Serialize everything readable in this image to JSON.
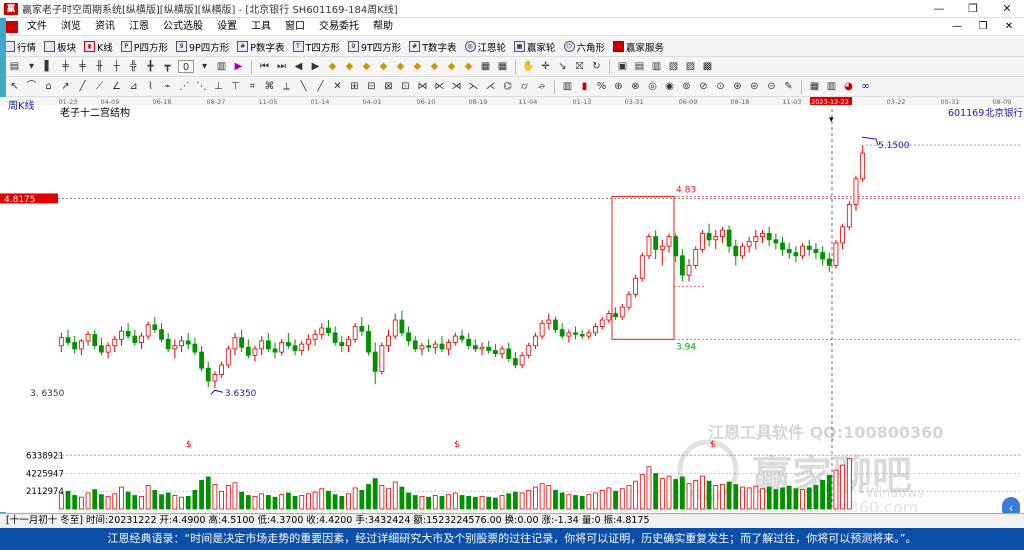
{
  "window": {
    "title": "赢家老子时空周期系统[纵横版][纵横版][纵横版] - [北京银行  SH601169-184周K线]",
    "logo_text": "赢"
  },
  "menu": [
    "文件",
    "浏览",
    "资讯",
    "江恩",
    "公式选股",
    "设置",
    "工具",
    "窗口",
    "交易委托",
    "帮助"
  ],
  "toolbar1": [
    {
      "icon": "grid-icon",
      "label": "行情"
    },
    {
      "icon": "blocks-icon",
      "label": "板块"
    },
    {
      "icon": "kline-icon",
      "label": "K线"
    },
    {
      "icon": "p-square-icon",
      "label": "P四方形"
    },
    {
      "icon": "9p-square-icon",
      "label": "9P四方形"
    },
    {
      "icon": "p-number-icon",
      "label": "P数字表"
    },
    {
      "icon": "t-square-icon",
      "label": "T四方形"
    },
    {
      "icon": "9t-square-icon",
      "label": "9T四方形"
    },
    {
      "icon": "t-number-icon",
      "label": "T数字表"
    },
    {
      "icon": "gann-wheel-icon",
      "label": "江恩轮"
    },
    {
      "icon": "winner-wheel-icon",
      "label": "赢家轮"
    },
    {
      "icon": "hexagon-icon",
      "label": "六角形"
    },
    {
      "icon": "service-icon",
      "label": "赢家服务"
    }
  ],
  "toolbar2_zoom": "0",
  "chart": {
    "period_label": "周K线",
    "indicator_label": "老子十二宫结构",
    "code": "601169",
    "name": "北京银行",
    "date_ticks": [
      "01-23",
      "04-09",
      "06-18",
      "08-27",
      "11-05",
      "01-14",
      "04-01",
      "06-10",
      "08-19",
      "11-04",
      "01-13",
      "03-31",
      "06-09",
      "08-18",
      "11-03",
      "2023-12-22",
      "03-22",
      "05-31",
      "08-09"
    ],
    "price_left_label": "4.8175",
    "high_label": "5.1500",
    "box_top_label": "4.83",
    "box_bottom_label": "3.94",
    "low_label": "3.6350",
    "low_axis_label": "3. 6350",
    "dollar_mark": "$",
    "vol_ticks": [
      "6338921",
      "4225947",
      "2112974"
    ],
    "watermark1": "江恩工具软件  QQ:100800360",
    "watermark2": "赢家聊吧",
    "watermark3": "Windows",
    "watermark4": "liaoba.yict360.com",
    "colors": {
      "up": "#e00000",
      "down": "#009000",
      "box": "#e02020",
      "accent": "#1a1aaa"
    }
  },
  "chart_data": {
    "type": "candlestick",
    "title": "老子十二宫结构",
    "ylabel": "",
    "ylim": [
      3.3,
      5.3
    ],
    "candles": [
      [
        3.9,
        3.98,
        3.86,
        3.95
      ],
      [
        3.95,
        4.0,
        3.9,
        3.92
      ],
      [
        3.92,
        3.96,
        3.85,
        3.88
      ],
      [
        3.88,
        3.94,
        3.84,
        3.93
      ],
      [
        3.93,
        3.99,
        3.9,
        3.97
      ],
      [
        3.97,
        4.0,
        3.88,
        3.9
      ],
      [
        3.9,
        3.95,
        3.84,
        3.86
      ],
      [
        3.86,
        3.92,
        3.82,
        3.9
      ],
      [
        3.9,
        3.96,
        3.86,
        3.94
      ],
      [
        3.94,
        4.02,
        3.9,
        3.99
      ],
      [
        3.99,
        4.04,
        3.94,
        3.96
      ],
      [
        3.96,
        4.0,
        3.9,
        3.92
      ],
      [
        3.92,
        3.98,
        3.88,
        3.96
      ],
      [
        3.96,
        4.05,
        3.94,
        4.03
      ],
      [
        4.03,
        4.08,
        3.98,
        4.0
      ],
      [
        4.0,
        4.04,
        3.92,
        3.94
      ],
      [
        3.94,
        3.98,
        3.86,
        3.88
      ],
      [
        3.88,
        3.94,
        3.82,
        3.9
      ],
      [
        3.9,
        3.96,
        3.86,
        3.93
      ],
      [
        3.93,
        3.98,
        3.88,
        3.91
      ],
      [
        3.91,
        3.95,
        3.84,
        3.86
      ],
      [
        3.86,
        3.9,
        3.74,
        3.76
      ],
      [
        3.76,
        3.8,
        3.64,
        3.68
      ],
      [
        3.68,
        3.74,
        3.635,
        3.72
      ],
      [
        3.72,
        3.8,
        3.7,
        3.78
      ],
      [
        3.78,
        3.9,
        3.76,
        3.88
      ],
      [
        3.88,
        3.98,
        3.84,
        3.95
      ],
      [
        3.95,
        4.0,
        3.86,
        3.89
      ],
      [
        3.89,
        3.94,
        3.82,
        3.84
      ],
      [
        3.84,
        3.9,
        3.8,
        3.88
      ],
      [
        3.88,
        3.96,
        3.84,
        3.93
      ],
      [
        3.93,
        3.98,
        3.86,
        3.88
      ],
      [
        3.88,
        3.92,
        3.82,
        3.86
      ],
      [
        3.86,
        3.94,
        3.84,
        3.92
      ],
      [
        3.92,
        3.98,
        3.88,
        3.9
      ],
      [
        3.9,
        3.94,
        3.84,
        3.87
      ],
      [
        3.87,
        3.93,
        3.84,
        3.91
      ],
      [
        3.91,
        3.97,
        3.87,
        3.94
      ],
      [
        3.94,
        4.0,
        3.9,
        3.97
      ],
      [
        3.97,
        4.04,
        3.94,
        4.01
      ],
      [
        4.01,
        4.06,
        3.96,
        3.98
      ],
      [
        3.98,
        4.02,
        3.9,
        3.92
      ],
      [
        3.92,
        3.96,
        3.86,
        3.9
      ],
      [
        3.9,
        3.96,
        3.86,
        3.94
      ],
      [
        3.94,
        4.04,
        3.92,
        4.02
      ],
      [
        4.02,
        4.08,
        3.96,
        3.99
      ],
      [
        3.99,
        4.03,
        3.84,
        3.86
      ],
      [
        3.86,
        3.92,
        3.66,
        3.74
      ],
      [
        3.74,
        3.92,
        3.72,
        3.9
      ],
      [
        3.9,
        4.0,
        3.86,
        3.96
      ],
      [
        3.96,
        4.1,
        3.94,
        4.06
      ],
      [
        4.06,
        4.12,
        3.96,
        3.98
      ],
      [
        3.98,
        4.02,
        3.9,
        3.93
      ],
      [
        3.93,
        3.96,
        3.86,
        3.88
      ],
      [
        3.88,
        3.92,
        3.84,
        3.9
      ],
      [
        3.9,
        3.94,
        3.86,
        3.89
      ],
      [
        3.89,
        3.93,
        3.85,
        3.91
      ],
      [
        3.91,
        3.96,
        3.86,
        3.88
      ],
      [
        3.88,
        3.94,
        3.84,
        3.92
      ],
      [
        3.92,
        3.98,
        3.9,
        3.96
      ],
      [
        3.96,
        4.0,
        3.92,
        3.94
      ],
      [
        3.94,
        3.98,
        3.88,
        3.9
      ],
      [
        3.9,
        3.94,
        3.86,
        3.88
      ],
      [
        3.88,
        3.92,
        3.84,
        3.89
      ],
      [
        3.89,
        3.93,
        3.85,
        3.87
      ],
      [
        3.87,
        3.91,
        3.83,
        3.85
      ],
      [
        3.85,
        3.9,
        3.82,
        3.88
      ],
      [
        3.88,
        3.92,
        3.8,
        3.82
      ],
      [
        3.82,
        3.86,
        3.76,
        3.78
      ],
      [
        3.78,
        3.86,
        3.76,
        3.84
      ],
      [
        3.84,
        3.92,
        3.82,
        3.9
      ],
      [
        3.9,
        3.98,
        3.88,
        3.96
      ],
      [
        3.96,
        4.06,
        3.94,
        4.04
      ],
      [
        4.04,
        4.1,
        4.0,
        4.06
      ],
      [
        4.06,
        4.08,
        3.98,
        4.0
      ],
      [
        4.0,
        4.04,
        3.94,
        3.96
      ],
      [
        3.96,
        4.0,
        3.92,
        3.98
      ],
      [
        3.98,
        4.02,
        3.94,
        3.97
      ],
      [
        3.97,
        4.0,
        3.94,
        3.96
      ],
      [
        3.96,
        4.0,
        3.94,
        3.98
      ],
      [
        3.98,
        4.04,
        3.96,
        4.02
      ],
      [
        4.02,
        4.08,
        4.0,
        4.06
      ],
      [
        4.06,
        4.12,
        4.04,
        4.1
      ],
      [
        4.1,
        4.14,
        4.06,
        4.08
      ],
      [
        4.08,
        4.16,
        4.06,
        4.14
      ],
      [
        4.14,
        4.24,
        4.12,
        4.22
      ],
      [
        4.22,
        4.34,
        4.2,
        4.32
      ],
      [
        4.32,
        4.48,
        4.3,
        4.46
      ],
      [
        4.46,
        4.6,
        4.44,
        4.58
      ],
      [
        4.58,
        4.62,
        4.44,
        4.5
      ],
      [
        4.5,
        4.56,
        4.4,
        4.52
      ],
      [
        4.52,
        4.6,
        4.48,
        4.58
      ],
      [
        4.58,
        4.6,
        4.42,
        4.46
      ],
      [
        4.46,
        4.5,
        4.3,
        4.34
      ],
      [
        4.34,
        4.44,
        4.3,
        4.4
      ],
      [
        4.4,
        4.52,
        4.38,
        4.5
      ],
      [
        4.5,
        4.62,
        4.48,
        4.6
      ],
      [
        4.6,
        4.66,
        4.52,
        4.56
      ],
      [
        4.56,
        4.62,
        4.5,
        4.58
      ],
      [
        4.58,
        4.64,
        4.54,
        4.62
      ],
      [
        4.62,
        4.65,
        4.48,
        4.52
      ],
      [
        4.52,
        4.56,
        4.4,
        4.46
      ],
      [
        4.46,
        4.54,
        4.44,
        4.52
      ],
      [
        4.52,
        4.58,
        4.48,
        4.55
      ],
      [
        4.55,
        4.62,
        4.5,
        4.58
      ],
      [
        4.58,
        4.62,
        4.54,
        4.6
      ],
      [
        4.6,
        4.64,
        4.52,
        4.56
      ],
      [
        4.56,
        4.6,
        4.5,
        4.54
      ],
      [
        4.54,
        4.58,
        4.46,
        4.5
      ],
      [
        4.5,
        4.54,
        4.44,
        4.48
      ],
      [
        4.48,
        4.52,
        4.42,
        4.46
      ],
      [
        4.46,
        4.54,
        4.44,
        4.52
      ],
      [
        4.52,
        4.56,
        4.46,
        4.5
      ],
      [
        4.5,
        4.54,
        4.44,
        4.48
      ],
      [
        4.48,
        4.52,
        4.4,
        4.44
      ],
      [
        4.44,
        4.48,
        4.36,
        4.4
      ],
      [
        4.4,
        4.56,
        4.38,
        4.54
      ],
      [
        4.54,
        4.66,
        4.5,
        4.64
      ],
      [
        4.64,
        4.8,
        4.62,
        4.78
      ],
      [
        4.78,
        4.96,
        4.74,
        4.94
      ],
      [
        4.94,
        5.15,
        4.92,
        5.1
      ]
    ],
    "volumes": [
      1.8,
      2.1,
      1.6,
      1.4,
      1.9,
      2.3,
      1.7,
      1.5,
      1.8,
      2.6,
      2.0,
      1.6,
      1.5,
      2.8,
      2.2,
      1.7,
      1.9,
      1.6,
      1.4,
      1.5,
      2.2,
      3.4,
      3.8,
      2.9,
      2.1,
      2.8,
      3.1,
      2.0,
      1.6,
      1.5,
      1.8,
      1.6,
      1.4,
      1.7,
      1.9,
      1.5,
      1.6,
      1.8,
      2.0,
      2.4,
      2.1,
      1.7,
      1.5,
      1.8,
      2.5,
      2.2,
      2.9,
      3.6,
      2.8,
      2.4,
      3.2,
      2.6,
      1.9,
      1.6,
      1.5,
      1.4,
      1.6,
      1.5,
      1.7,
      1.9,
      1.6,
      1.5,
      1.4,
      1.5,
      1.4,
      1.3,
      1.6,
      1.8,
      2.0,
      1.9,
      2.2,
      2.6,
      3.0,
      2.8,
      2.2,
      1.9,
      1.7,
      1.6,
      1.5,
      1.7,
      1.9,
      2.2,
      2.5,
      2.1,
      2.4,
      2.8,
      3.3,
      4.1,
      5.0,
      4.2,
      3.6,
      3.9,
      3.5,
      3.8,
      3.0,
      3.4,
      3.9,
      3.3,
      2.8,
      2.9,
      3.2,
      2.9,
      2.6,
      2.5,
      2.7,
      2.4,
      2.6,
      2.3,
      2.5,
      2.7,
      2.4,
      2.3,
      2.5,
      2.8,
      3.4,
      4.0,
      4.6,
      5.2,
      6.0
    ]
  },
  "status": "[十一月初十 冬至]  时间:20231222  开:4.4900  高:4.5100  低:4.3700  收:4.4200  手:3432424  额:1523224576.00  换:0.00  涨:-1.34  量:0  振:4.8175",
  "quote": "江恩经典语录：“时间是决定市场走势的重要因素，经过详细研究大市及个别股票的过往记录，你将可以证明，历史确实重复发生；而了解过往，你将可以预测将来。”。"
}
